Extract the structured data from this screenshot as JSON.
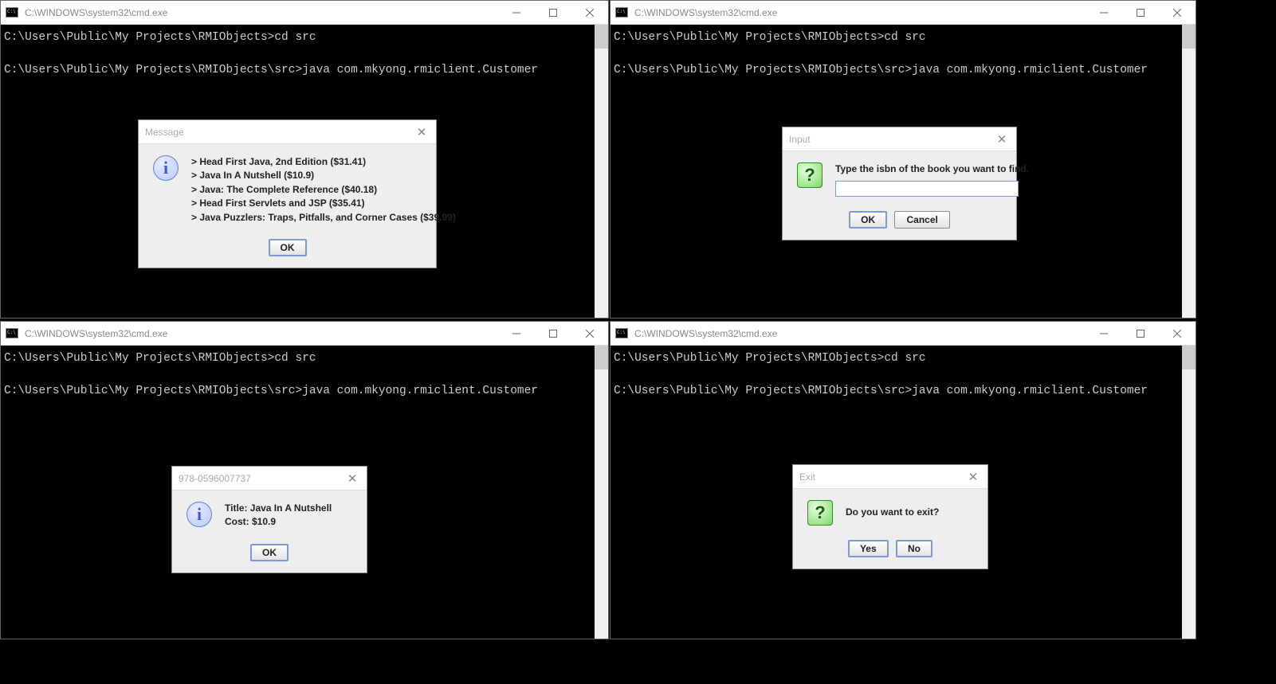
{
  "cmd_title": "C:\\WINDOWS\\system32\\cmd.exe",
  "term_lines": [
    "C:\\Users\\Public\\My Projects\\RMIObjects>cd src",
    "",
    "C:\\Users\\Public\\My Projects\\RMIObjects\\src>java com.mkyong.rmiclient.Customer"
  ],
  "dialog_message": {
    "title": "Message",
    "lines": [
      "> Head First Java, 2nd Edition ($31.41)",
      "> Java In A Nutshell ($10.9)",
      "> Java: The Complete Reference ($40.18)",
      "> Head First Servlets and JSP ($35.41)",
      "> Java Puzzlers: Traps, Pitfalls, and Corner Cases ($39.99)"
    ],
    "ok": "OK"
  },
  "dialog_input": {
    "title": "Input",
    "prompt": "Type the isbn of the book you want to find.",
    "value": "",
    "ok": "OK",
    "cancel": "Cancel"
  },
  "dialog_isbn": {
    "title": "978-0596007737",
    "line1": "Title: Java In A Nutshell",
    "line2": "Cost: $10.9",
    "ok": "OK"
  },
  "dialog_exit": {
    "title": "Exit",
    "prompt": "Do you want to exit?",
    "yes": "Yes",
    "no": "No"
  }
}
